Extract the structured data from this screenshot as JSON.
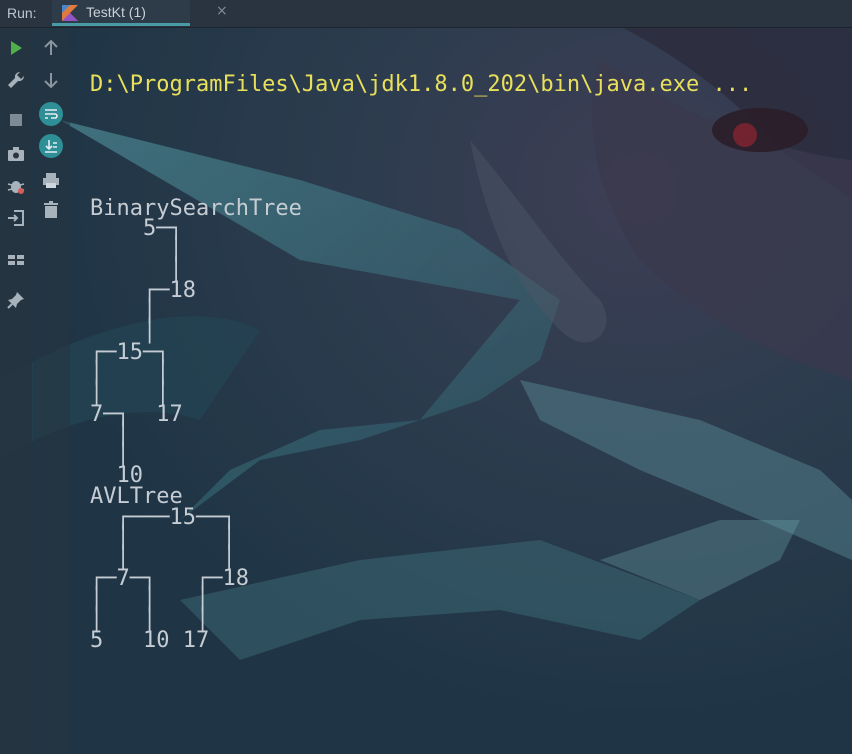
{
  "toolwindow": {
    "run_label": "Run:",
    "tab_label": "TestKt (1)",
    "tab_close": "×",
    "accent_color": "#4a9aa6"
  },
  "left_toolbar": [
    {
      "name": "run-icon",
      "color": "#4fb04a"
    },
    {
      "name": "wrench-icon"
    },
    {
      "name": "stop-icon"
    },
    {
      "name": "camera-icon"
    },
    {
      "name": "debug-icon"
    },
    {
      "name": "exit-icon"
    },
    {
      "name": "layout-icon"
    },
    {
      "name": "pin-icon"
    }
  ],
  "secondary_toolbar": [
    {
      "name": "arrow-up-icon"
    },
    {
      "name": "arrow-down-icon"
    },
    {
      "name": "soft-wrap-icon",
      "active": true
    },
    {
      "name": "scroll-to-end-icon",
      "active": true
    },
    {
      "name": "print-icon"
    },
    {
      "name": "trash-icon"
    }
  ],
  "console": {
    "command": "D:\\ProgramFiles\\Java\\jdk1.8.0_202\\bin\\java.exe ...",
    "lines": [
      "BinarySearchTree",
      "    5─┐",
      "      │",
      "      │",
      "    ┌─18",
      "    │",
      "    │",
      "┌─15─┐",
      "│    │",
      "│    │",
      "7─┐  17",
      "  │",
      "  │",
      "  10",
      "AVLTree",
      "  ┌───15──┐",
      "  │       │",
      "  │       │",
      "┌─7─┐   ┌─18",
      "│   │   │",
      "│   │   │",
      "5   10 17"
    ]
  }
}
